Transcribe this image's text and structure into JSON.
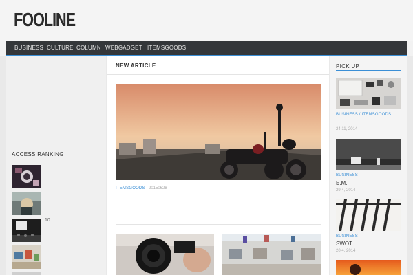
{
  "site": {
    "logo": "FOOLINE"
  },
  "nav": {
    "items": [
      "BUSINESS",
      "CULTURE",
      "COLUMN",
      "WEBGADGET",
      "ITEMSGOODS"
    ]
  },
  "main": {
    "section_title": "NEW ARTICLE",
    "featured": {
      "category": "ITEMSGOODS",
      "date": "20150628",
      "image_icon": "motorcycle-sunset-photo"
    }
  },
  "sidebar_left": {
    "title": "ACCESS RANKING",
    "items": [
      {
        "count": "",
        "image_icon": "camera-top-view"
      },
      {
        "count": "",
        "image_icon": "cockpit-photo"
      },
      {
        "count": "10",
        "image_icon": "dark-room-photo"
      },
      {
        "count": "",
        "image_icon": "colorful-room-photo"
      }
    ]
  },
  "sidebar_right": {
    "title": "PICK UP",
    "items": [
      {
        "category": "BUSINESS / ITEMSGOODS",
        "date": "24.11, 2014",
        "title": "",
        "image_icon": "gadgets-flatlay"
      },
      {
        "category": "BUSINESS",
        "date": "29.4, 2014",
        "title": "E.M.",
        "image_icon": "piano-stage"
      },
      {
        "category": "BUSINESS",
        "date": "20.4, 2014",
        "title": "SWOT",
        "image_icon": "fence-shadow"
      },
      {
        "category": "",
        "date": "",
        "title": "",
        "image_icon": "sunset-silhouette"
      }
    ]
  },
  "colors": {
    "accent": "#3b8fd6",
    "nav_bg": "#34373a"
  }
}
